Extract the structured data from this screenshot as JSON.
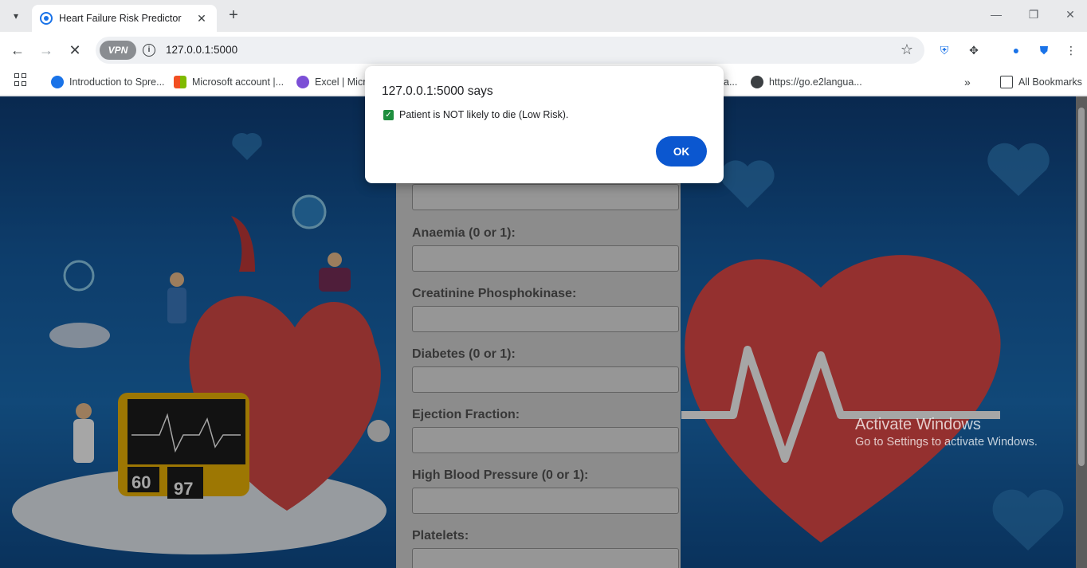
{
  "browser": {
    "tab_title": "Heart Failure Risk Predictor",
    "url": "127.0.0.1:5000",
    "vpn_label": "VPN",
    "bookmarks": [
      {
        "label": "Introduction to Spre...",
        "color": "#1a73e8"
      },
      {
        "label": "Microsoft account |...",
        "color": "#f25022"
      },
      {
        "label": "Excel | Micro",
        "color": "#7b4fd6"
      },
      {
        "label": "a...",
        "color": ""
      },
      {
        "label": "https://go.e2langua...",
        "color": "#3c4043"
      }
    ],
    "all_bookmarks": "All Bookmarks"
  },
  "form": {
    "fields": [
      {
        "label": ""
      },
      {
        "label": "Anaemia (0 or 1):"
      },
      {
        "label": "Creatinine Phosphokinase:"
      },
      {
        "label": "Diabetes (0 or 1):"
      },
      {
        "label": "Ejection Fraction:"
      },
      {
        "label": "High Blood Pressure (0 or 1):"
      },
      {
        "label": "Platelets:"
      }
    ]
  },
  "illustration": {
    "monitor_value_1": "60",
    "monitor_value_2": "97"
  },
  "dialog": {
    "title": "127.0.0.1:5000 says",
    "message": "Patient is NOT likely to die (Low Risk).",
    "ok_label": "OK"
  },
  "watermark": {
    "line1": "Activate Windows",
    "line2": "Go to Settings to activate Windows."
  }
}
